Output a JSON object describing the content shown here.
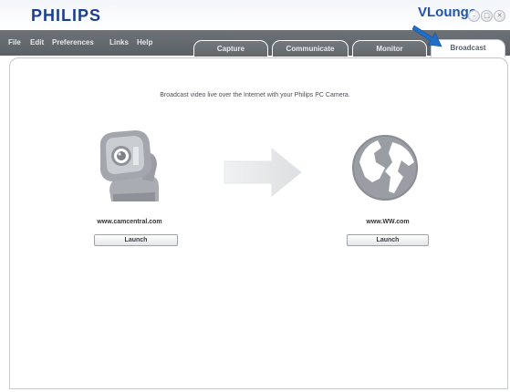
{
  "brand": {
    "logo": "PHILIPS",
    "app_name": "VLounge"
  },
  "window_controls": {
    "minimize_glyph": "–",
    "maximize_glyph": "□",
    "close_glyph": "✕"
  },
  "menu": {
    "items": [
      "File",
      "Edit",
      "Preferences",
      "Links",
      "Help"
    ]
  },
  "tabs": [
    {
      "label": "Capture",
      "active": false
    },
    {
      "label": "Communicate",
      "active": false
    },
    {
      "label": "Monitor",
      "active": false
    },
    {
      "label": "Broadcast",
      "active": true
    }
  ],
  "main": {
    "description": "Broadcast video live over the Internet with your Philips PC Camera.",
    "left": {
      "site": "www.camcentral.com",
      "button": "Launch",
      "icon": "webcam-icon"
    },
    "right": {
      "site": "www.WW.com",
      "button": "Launch",
      "icon": "globe-icon"
    },
    "center_icon": "arrow-right-icon"
  },
  "colors": {
    "brand_blue": "#1d3f8e",
    "accent_blue": "#1f6fc9",
    "menubar_gray": "#63686d"
  }
}
